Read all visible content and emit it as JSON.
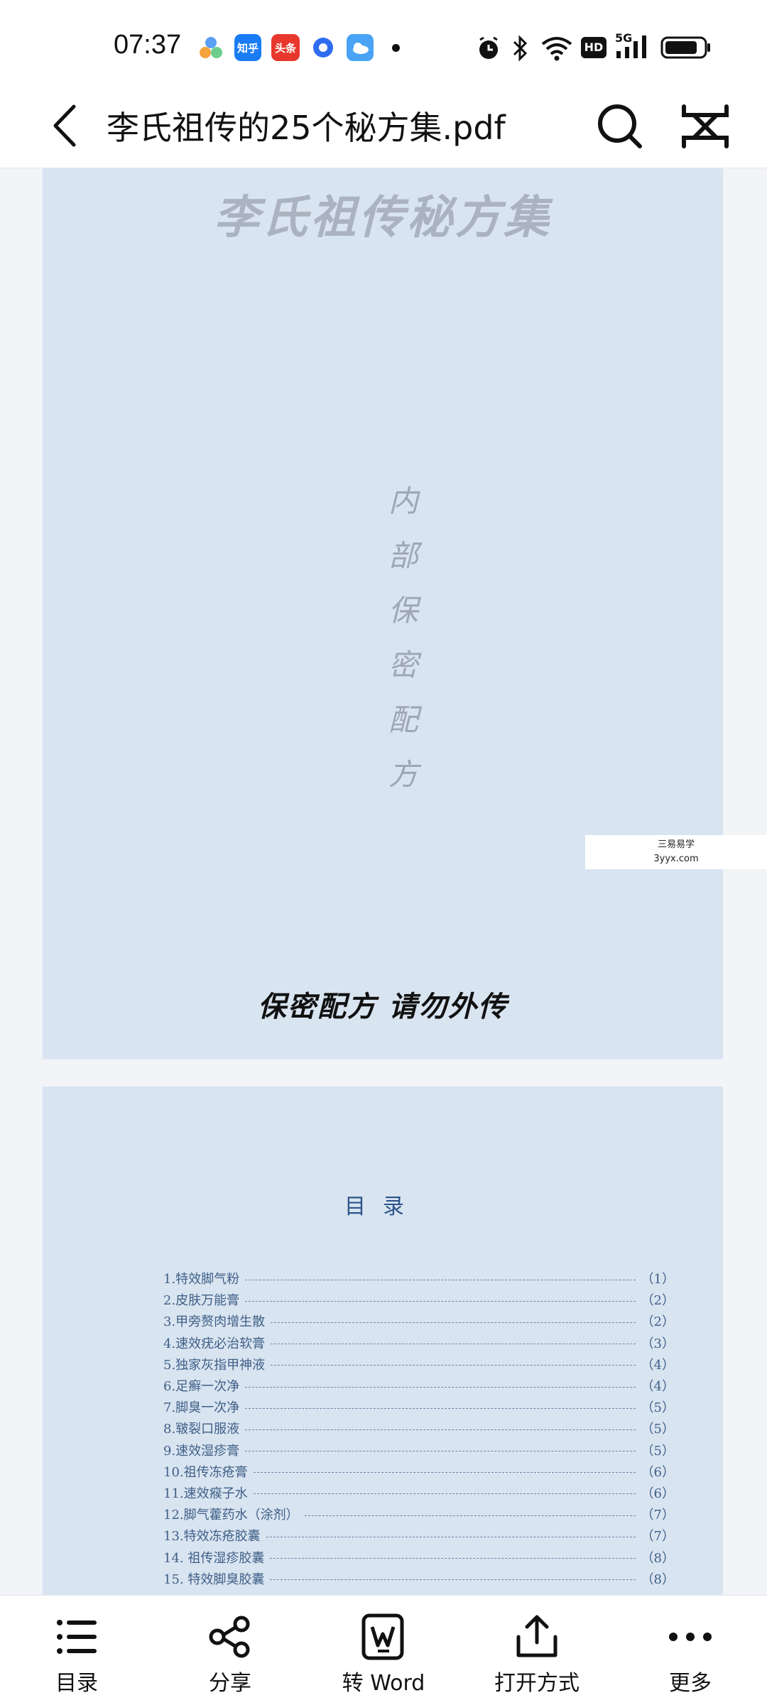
{
  "status_bar": {
    "time": "07:37",
    "notifications": [
      {
        "name": "app-icon-1",
        "label": ""
      },
      {
        "name": "zhihu-icon",
        "label": "知乎",
        "color": "#1a7cf5"
      },
      {
        "name": "toutiao-icon",
        "label": "头条",
        "color": "#e8382d"
      },
      {
        "name": "blue-dot-app-icon",
        "label": "",
        "color": "#2f6cf2"
      },
      {
        "name": "weather-icon",
        "label": "",
        "color": "#4aa3f5"
      }
    ],
    "system_icons": [
      "alarm-icon",
      "bluetooth-icon",
      "wifi-icon",
      "hd-icon",
      "signal-5g-icon",
      "battery-icon"
    ],
    "hd_label": "HD",
    "network_label": "5G"
  },
  "app_bar": {
    "title": "李氏祖传的25个秘方集.pdf"
  },
  "pdf": {
    "page1": {
      "title": "李氏祖传秘方集",
      "vertical_text": [
        "内",
        "部",
        "保",
        "密",
        "配",
        "方"
      ],
      "footer": "保密配方 请勿外传",
      "watermark_line1": "三易易学",
      "watermark_line2": "3yyx.com"
    },
    "page2": {
      "toc_title": "目录",
      "toc": [
        {
          "label": "1.特效脚气粉",
          "page": "（1）"
        },
        {
          "label": "2.皮肤万能膏",
          "page": "（2）"
        },
        {
          "label": "3.甲旁赘肉增生散",
          "page": "（2）"
        },
        {
          "label": "4.速效疣必治软膏",
          "page": "（3）"
        },
        {
          "label": "5.独家灰指甲神液",
          "page": "（4）"
        },
        {
          "label": "6.足癣一次净",
          "page": "（4）"
        },
        {
          "label": "7.脚臭一次净",
          "page": "（5）"
        },
        {
          "label": "8.皲裂口服液",
          "page": "（5）"
        },
        {
          "label": "9.速效湿疹膏",
          "page": "（5）"
        },
        {
          "label": "10.祖传冻疮膏",
          "page": "（6）"
        },
        {
          "label": "11.速效瘊子水",
          "page": "（6）"
        },
        {
          "label": "12.脚气藿药水（涂剂）",
          "page": "（7）"
        },
        {
          "label": "13.特效冻疮胶囊",
          "page": "（7）"
        },
        {
          "label": "14. 祖传湿疹胶囊",
          "page": "（8）"
        },
        {
          "label": "15. 特效脚臭胶囊",
          "page": "（8）"
        }
      ]
    }
  },
  "toolbar": {
    "items": [
      {
        "name": "toc",
        "label": "目录",
        "icon": "list-icon"
      },
      {
        "name": "share",
        "label": "分享",
        "icon": "share-icon"
      },
      {
        "name": "to-word",
        "label": "转 Word",
        "icon": "word-icon"
      },
      {
        "name": "open-with",
        "label": "打开方式",
        "icon": "upload-icon"
      },
      {
        "name": "more",
        "label": "更多",
        "icon": "more-icon"
      }
    ]
  },
  "colors": {
    "page_bg": "#d9e4f1",
    "toc_text": "#3e5f86",
    "toc_title": "#2b5487"
  }
}
